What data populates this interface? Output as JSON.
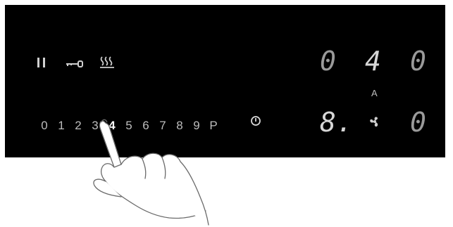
{
  "controls": {
    "pause_icon": "pause-icon",
    "lock_icon": "key-lock-icon",
    "warm_icon": "keep-warm-icon",
    "power_icon": "power-icon",
    "fan_icon": "fan-icon"
  },
  "slider": {
    "digits": [
      "0",
      "1",
      "2",
      "3",
      "4",
      "5",
      "6",
      "7",
      "8",
      "9",
      "P"
    ],
    "selected": "4"
  },
  "display": {
    "top_row": [
      "0",
      "4",
      "0"
    ],
    "bottom_left": "8.",
    "bottom_right": "0",
    "mode_label": "A"
  },
  "colors": {
    "panel": "#000000",
    "text": "#cfcfcf",
    "background": "#ffffff"
  }
}
